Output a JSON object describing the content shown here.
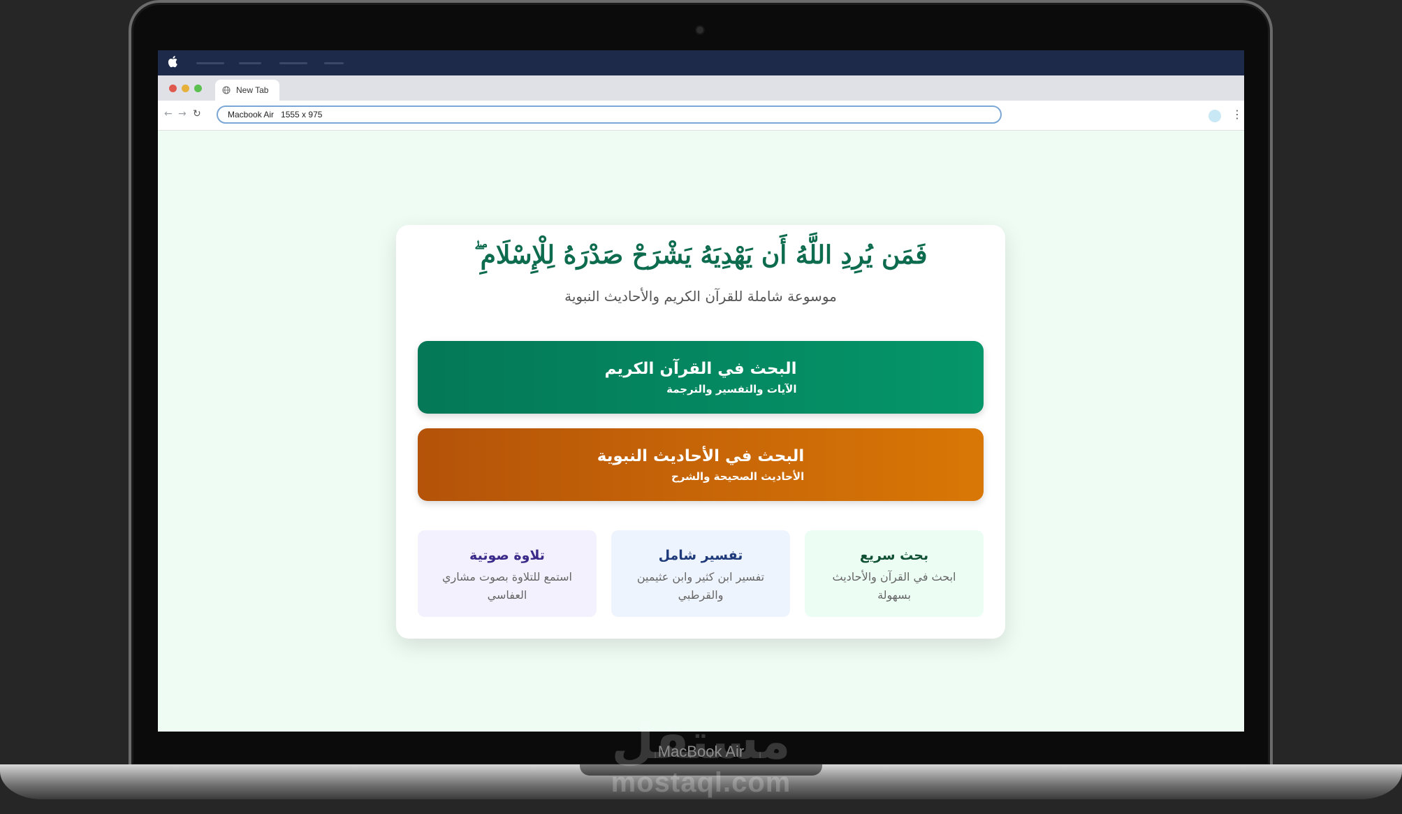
{
  "device": {
    "model_label": "MacBook Air",
    "watermark_ar": "مستقل",
    "watermark_en": "mostaql.com"
  },
  "browser": {
    "tab_title": "New Tab",
    "url_text": "Macbook Air   1555 x 975",
    "traffic_colors": [
      "#e0594f",
      "#e6b03a",
      "#5bc04f"
    ]
  },
  "page": {
    "verse": "فَمَن يُرِدِ اللَّهُ أَن يَهْدِيَهُ يَشْرَحْ صَدْرَهُ لِلْإِسْلَامِ ۖ",
    "subtitle": "موسوعة شاملة للقرآن الكريم والأحاديث النبوية",
    "quran_button": {
      "title": "البحث في القرآن الكريم",
      "subtitle": "الآيات والتفسير والترجمة"
    },
    "hadith_button": {
      "title": "البحث في الأحاديث النبوية",
      "subtitle": "الأحاديث الصحيحة والشرح"
    },
    "features": {
      "quick": {
        "title": "بحث سريع",
        "desc": "ابحث في القرآن والأحاديث بسهولة"
      },
      "tafsir": {
        "title": "تفسير شامل",
        "desc": "تفسير ابن كثير وابن عثيمين والقرطبي"
      },
      "audio": {
        "title": "تلاوة صوتية",
        "desc": "استمع للتلاوة بصوت مشاري العفاسي"
      }
    },
    "colors": {
      "primary_green": "#047857",
      "primary_orange": "#d97706",
      "background": "#effcf4"
    }
  }
}
